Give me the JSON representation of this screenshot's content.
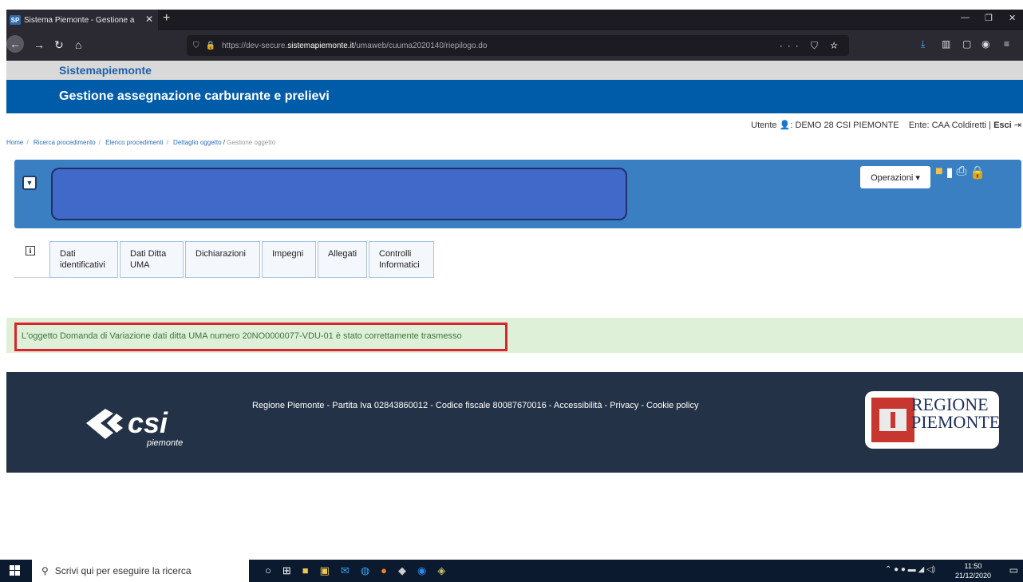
{
  "browser": {
    "tab_title": "Sistema Piemonte - Gestione a",
    "tab_favicon": "SP",
    "url_prefix": "https://dev-secure.",
    "url_host": "sistemapiemonte.it",
    "url_path": "/umaweb/cuuma2020140/riepilogo.do",
    "new_tab_symbol": "+",
    "close_symbol": "✕",
    "url_actions": "··· ⛉ ☆"
  },
  "site": {
    "brand": "Sistemapiemonte",
    "app_title": "Gestione assegnazione carburante e prelievi"
  },
  "userbar": {
    "user_label": "Utente",
    "user_name": "DEMO 28 CSI PIEMONTE",
    "ente": "Ente: CAA Coldiretti",
    "logout": "Esci"
  },
  "breadcrumb": {
    "items": [
      "Home",
      "Ricerca procedimento",
      "Elenco procedimenti",
      "Dettaglio oggetto"
    ],
    "current": "Gestione oggetto"
  },
  "panel": {
    "operations_label": "Operazioni ▾",
    "icons": [
      "folder-icon",
      "document-icon",
      "print-icon",
      "lock-icon"
    ]
  },
  "tabs": [
    {
      "label": "Dati identificativi"
    },
    {
      "label": "Dati Ditta UMA"
    },
    {
      "label": "Dichiarazioni"
    },
    {
      "label": "Impegni"
    },
    {
      "label": "Allegati"
    },
    {
      "label": "Controlli Informatici"
    }
  ],
  "info_tab_label": "i",
  "message": "L'oggetto Domanda di Variazione dati ditta UMA numero 20NO0000077-VDU-01 è stato correttamente trasmesso",
  "footer": {
    "text": "Regione Piemonte - Partita Iva 02843860012 - Codice fiscale 80087670016 - Accessibilità - Privacy - Cookie policy",
    "csi_brand": "csi",
    "csi_sub": "piemonte",
    "regione_line1": "REGIONE",
    "regione_line2": "PIEMONTE"
  },
  "taskbar": {
    "search_placeholder": "Scrivi qui per eseguire la ricerca",
    "time": "11:50",
    "date": "21/12/2020"
  },
  "colors": {
    "banner_blue": "#005ca9",
    "panel_blue": "#3a7fc1",
    "success_bg": "#dff0d8",
    "highlight_red": "#d9262d",
    "footer_bg": "#243247"
  }
}
